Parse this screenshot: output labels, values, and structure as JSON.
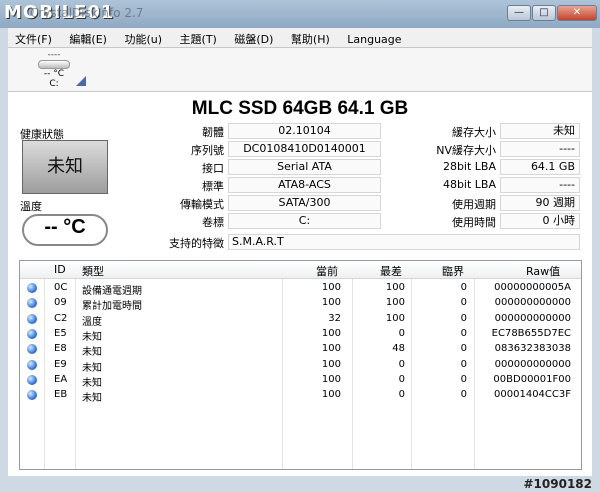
{
  "titlebar": {
    "watermark": "MOBILE01",
    "app_title": "CrystalDiskInfo 2.7"
  },
  "window_controls": {
    "minimize": "—",
    "maximize": "□",
    "close": "✕"
  },
  "menu": [
    "文件(F)",
    "編輯(E)",
    "功能(u)",
    "主題(T)",
    "磁盤(D)",
    "幫助(H)",
    "Language"
  ],
  "toolbar": {
    "disk": {
      "status": "----",
      "temp": "-- °C",
      "letter": "C:"
    }
  },
  "drive": {
    "model": "MLC SSD 64GB  64.1 GB"
  },
  "health": {
    "label": "健康狀態",
    "value": "未知"
  },
  "temperature": {
    "label": "溫度",
    "value": "-- °C"
  },
  "info_left": [
    {
      "label": "韌體",
      "value": "02.10104"
    },
    {
      "label": "序列號",
      "value": "DC0108410D0140001"
    },
    {
      "label": "接口",
      "value": "Serial ATA"
    },
    {
      "label": "標準",
      "value": "ATA8-ACS"
    },
    {
      "label": "傳輸模式",
      "value": "SATA/300"
    },
    {
      "label": "卷標",
      "value": "C:"
    }
  ],
  "features": {
    "label": "支持的特徵",
    "value": "S.M.A.R.T"
  },
  "info_right": [
    {
      "label": "緩存大小",
      "value": "未知"
    },
    {
      "label": "NV緩存大小",
      "value": "----"
    },
    {
      "label": "28bit LBA",
      "value": "64.1 GB"
    },
    {
      "label": "48bit LBA",
      "value": "----"
    },
    {
      "label": "使用週期",
      "value": "90 週期"
    },
    {
      "label": "使用時間",
      "value": "0 小時"
    }
  ],
  "table": {
    "headers": {
      "id": "ID",
      "type": "類型",
      "current": "當前",
      "worst": "最差",
      "threshold": "臨界",
      "raw": "Raw值"
    },
    "rows": [
      {
        "id": "0C",
        "type": "設備通電週期",
        "current": "100",
        "worst": "100",
        "threshold": "0",
        "raw": "00000000005A"
      },
      {
        "id": "09",
        "type": "累計加電時間",
        "current": "100",
        "worst": "100",
        "threshold": "0",
        "raw": "000000000000"
      },
      {
        "id": "C2",
        "type": "溫度",
        "current": "32",
        "worst": "100",
        "threshold": "0",
        "raw": "000000000000"
      },
      {
        "id": "E5",
        "type": "未知",
        "current": "100",
        "worst": "0",
        "threshold": "0",
        "raw": "EC78B655D7EC"
      },
      {
        "id": "E8",
        "type": "未知",
        "current": "100",
        "worst": "48",
        "threshold": "0",
        "raw": "083632383038"
      },
      {
        "id": "E9",
        "type": "未知",
        "current": "100",
        "worst": "0",
        "threshold": "0",
        "raw": "000000000000"
      },
      {
        "id": "EA",
        "type": "未知",
        "current": "100",
        "worst": "0",
        "threshold": "0",
        "raw": "00BD00001F00"
      },
      {
        "id": "EB",
        "type": "未知",
        "current": "100",
        "worst": "0",
        "threshold": "0",
        "raw": "00001404CC3F"
      }
    ]
  },
  "watermark_bottom": "#1090182",
  "colors": {
    "status_dot": "#3a78d8",
    "titlebar": "#9fb7cf"
  }
}
